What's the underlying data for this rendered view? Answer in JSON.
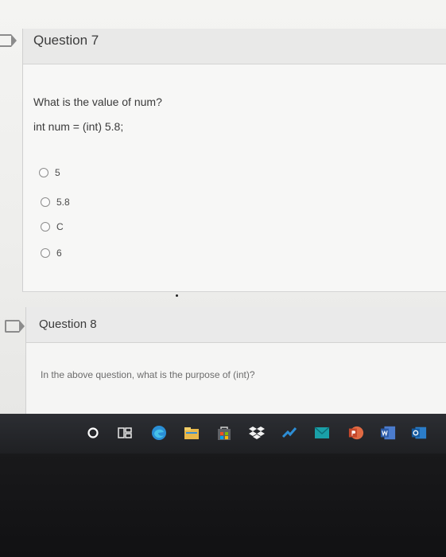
{
  "question7": {
    "title": "Question 7",
    "prompt": "What is the value of num?",
    "code": "int num = (int) 5.8;",
    "options": [
      "5",
      "5.8",
      "C",
      "6"
    ]
  },
  "question8": {
    "title": "Question 8",
    "prompt": "In the above question, what is the purpose of (int)?"
  },
  "taskbar": {
    "icons": [
      "search-circle-icon",
      "task-view-icon",
      "edge-icon",
      "file-explorer-icon",
      "store-icon",
      "dropbox-icon",
      "stocks-icon",
      "mail-icon",
      "powerpoint-icon",
      "word-icon",
      "outlook-icon"
    ]
  }
}
